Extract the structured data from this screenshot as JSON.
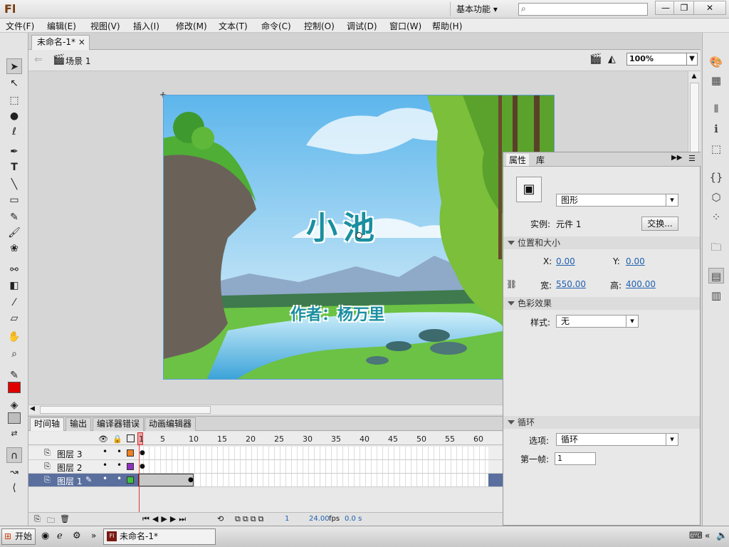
{
  "app": {
    "logo": "Fl",
    "workspace": "基本功能",
    "search_placeholder": ""
  },
  "window_buttons": {
    "minimize": "—",
    "restore": "❐",
    "close": "✕"
  },
  "menu": [
    "文件(F)",
    "编辑(E)",
    "视图(V)",
    "插入(I)",
    "修改(M)",
    "文本(T)",
    "命令(C)",
    "控制(O)",
    "调试(D)",
    "窗口(W)",
    "帮助(H)"
  ],
  "document": {
    "tab_title": "未命名-1*",
    "tab_close": "×",
    "scene": "场景 1",
    "zoom": "100%"
  },
  "stage": {
    "title": "小池",
    "author": "作者：杨万里"
  },
  "timeline": {
    "tabs": [
      "时间轴",
      "输出",
      "编译器错误",
      "动画编辑器"
    ],
    "frame_numbers": [
      "1",
      "5",
      "10",
      "15",
      "20",
      "25",
      "30",
      "35",
      "40",
      "45",
      "50",
      "55",
      "60"
    ],
    "layers": [
      {
        "name": "图层 3",
        "color": "#f08020"
      },
      {
        "name": "图层 2",
        "color": "#9030c0"
      },
      {
        "name": "图层 1",
        "color": "#40c040"
      }
    ],
    "status": {
      "frame": "1",
      "fps": "24.00",
      "fps_unit": "fps",
      "time": "0.0 s"
    }
  },
  "properties": {
    "tabs": [
      "属性",
      "库"
    ],
    "symbol_type": "图形",
    "instance_label": "实例:",
    "instance_name": "元件 1",
    "swap_button": "交换...",
    "section_position": "位置和大小",
    "x_label": "X:",
    "x_value": "0.00",
    "y_label": "Y:",
    "y_value": "0.00",
    "w_label": "宽:",
    "w_value": "550.00",
    "h_label": "高:",
    "h_value": "400.00",
    "section_color": "色彩效果",
    "style_label": "样式:",
    "style_value": "无",
    "section_loop": "循环",
    "option_label": "选项:",
    "option_value": "循环",
    "first_frame_label": "第一帧:",
    "first_frame_value": "1"
  },
  "taskbar": {
    "start": "开始",
    "task_title": "未命名-1*"
  }
}
